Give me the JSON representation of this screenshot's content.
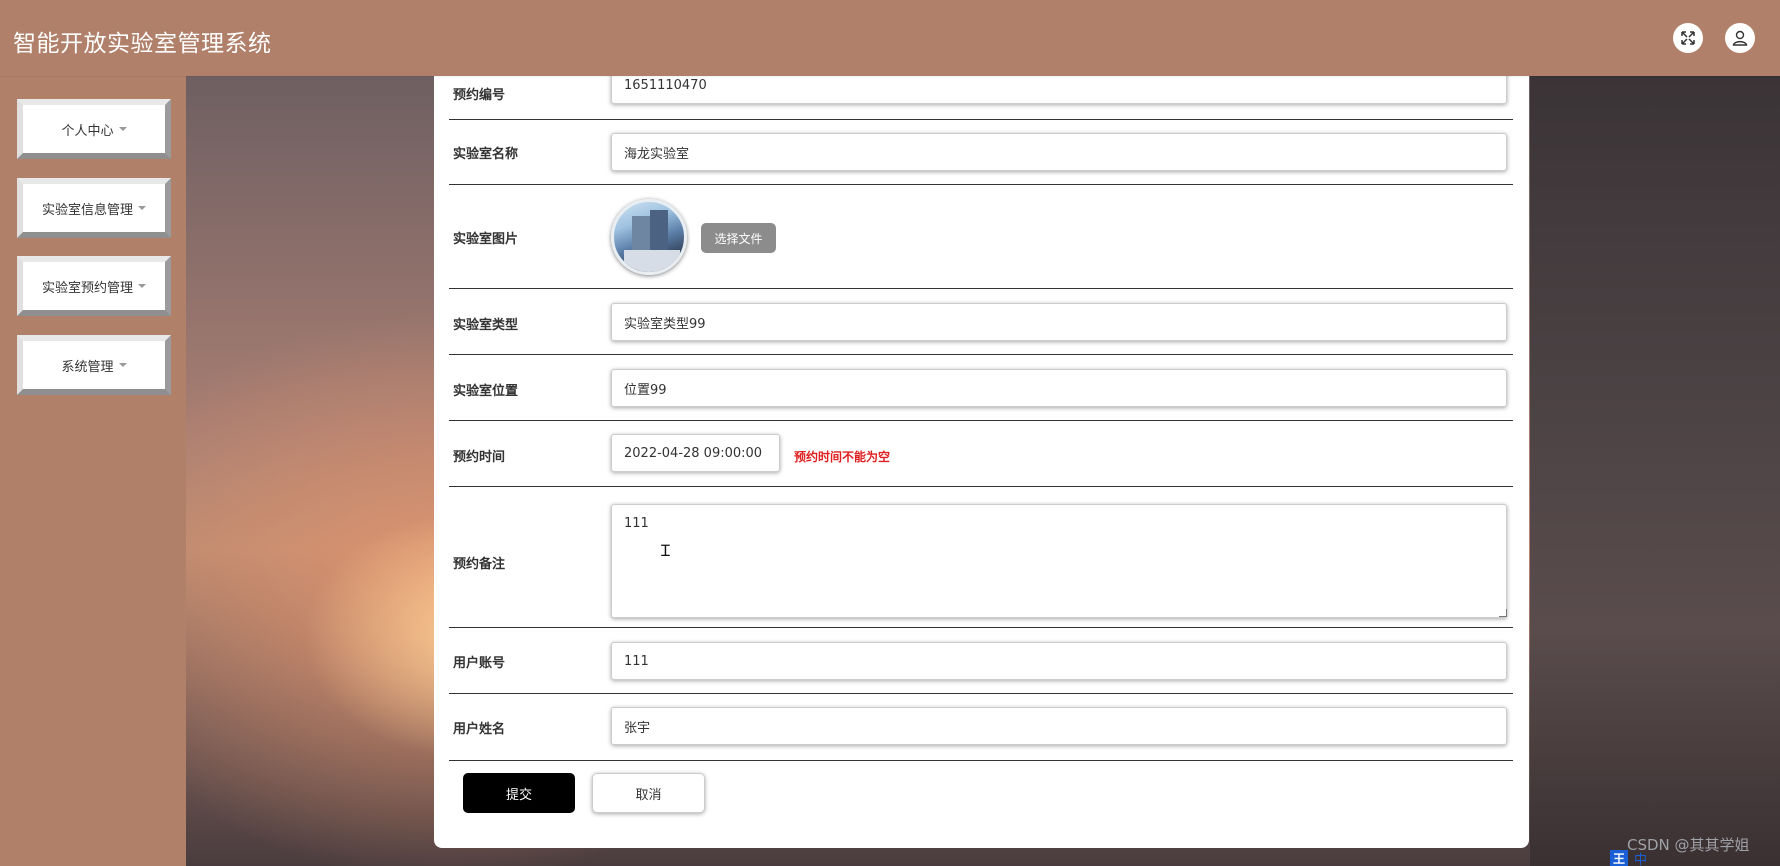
{
  "app": {
    "title": "智能开放实验室管理系统"
  },
  "header": {
    "fullscreen_icon": "fullscreen-icon",
    "user_icon": "user-icon"
  },
  "sidebar": {
    "items": [
      {
        "label": "个人中心"
      },
      {
        "label": "实验室信息管理"
      },
      {
        "label": "实验室预约管理"
      },
      {
        "label": "系统管理"
      }
    ]
  },
  "form": {
    "reservation_no": {
      "label": "预约编号",
      "value": "1651110470"
    },
    "lab_name": {
      "label": "实验室名称",
      "value": "海龙实验室"
    },
    "lab_image": {
      "label": "实验室图片",
      "button": "选择文件"
    },
    "lab_type": {
      "label": "实验室类型",
      "value": "实验室类型99"
    },
    "lab_location": {
      "label": "实验室位置",
      "value": "位置99"
    },
    "reservation_time": {
      "label": "预约时间",
      "value": "2022-04-28 09:00:00",
      "error": "预约时间不能为空"
    },
    "remark": {
      "label": "预约备注",
      "value": "111"
    },
    "user_account": {
      "label": "用户账号",
      "value": "111"
    },
    "user_name": {
      "label": "用户姓名",
      "value": "张宇"
    },
    "submit_label": "提交",
    "cancel_label": "取消"
  },
  "watermark": "CSDN @其其学姐",
  "ime": {
    "logo": "王",
    "mode": "中"
  },
  "colors": {
    "header": "#b0806a",
    "error": "#e02020",
    "submit_bg": "#000000"
  }
}
